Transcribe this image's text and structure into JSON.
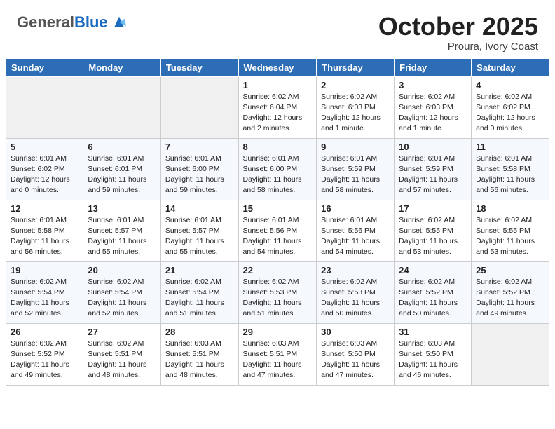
{
  "header": {
    "logo_general": "General",
    "logo_blue": "Blue",
    "month_title": "October 2025",
    "location": "Proura, Ivory Coast"
  },
  "days_of_week": [
    "Sunday",
    "Monday",
    "Tuesday",
    "Wednesday",
    "Thursday",
    "Friday",
    "Saturday"
  ],
  "weeks": [
    [
      {
        "day": "",
        "info": ""
      },
      {
        "day": "",
        "info": ""
      },
      {
        "day": "",
        "info": ""
      },
      {
        "day": "1",
        "info": "Sunrise: 6:02 AM\nSunset: 6:04 PM\nDaylight: 12 hours\nand 2 minutes."
      },
      {
        "day": "2",
        "info": "Sunrise: 6:02 AM\nSunset: 6:03 PM\nDaylight: 12 hours\nand 1 minute."
      },
      {
        "day": "3",
        "info": "Sunrise: 6:02 AM\nSunset: 6:03 PM\nDaylight: 12 hours\nand 1 minute."
      },
      {
        "day": "4",
        "info": "Sunrise: 6:02 AM\nSunset: 6:02 PM\nDaylight: 12 hours\nand 0 minutes."
      }
    ],
    [
      {
        "day": "5",
        "info": "Sunrise: 6:01 AM\nSunset: 6:02 PM\nDaylight: 12 hours\nand 0 minutes."
      },
      {
        "day": "6",
        "info": "Sunrise: 6:01 AM\nSunset: 6:01 PM\nDaylight: 11 hours\nand 59 minutes."
      },
      {
        "day": "7",
        "info": "Sunrise: 6:01 AM\nSunset: 6:00 PM\nDaylight: 11 hours\nand 59 minutes."
      },
      {
        "day": "8",
        "info": "Sunrise: 6:01 AM\nSunset: 6:00 PM\nDaylight: 11 hours\nand 58 minutes."
      },
      {
        "day": "9",
        "info": "Sunrise: 6:01 AM\nSunset: 5:59 PM\nDaylight: 11 hours\nand 58 minutes."
      },
      {
        "day": "10",
        "info": "Sunrise: 6:01 AM\nSunset: 5:59 PM\nDaylight: 11 hours\nand 57 minutes."
      },
      {
        "day": "11",
        "info": "Sunrise: 6:01 AM\nSunset: 5:58 PM\nDaylight: 11 hours\nand 56 minutes."
      }
    ],
    [
      {
        "day": "12",
        "info": "Sunrise: 6:01 AM\nSunset: 5:58 PM\nDaylight: 11 hours\nand 56 minutes."
      },
      {
        "day": "13",
        "info": "Sunrise: 6:01 AM\nSunset: 5:57 PM\nDaylight: 11 hours\nand 55 minutes."
      },
      {
        "day": "14",
        "info": "Sunrise: 6:01 AM\nSunset: 5:57 PM\nDaylight: 11 hours\nand 55 minutes."
      },
      {
        "day": "15",
        "info": "Sunrise: 6:01 AM\nSunset: 5:56 PM\nDaylight: 11 hours\nand 54 minutes."
      },
      {
        "day": "16",
        "info": "Sunrise: 6:01 AM\nSunset: 5:56 PM\nDaylight: 11 hours\nand 54 minutes."
      },
      {
        "day": "17",
        "info": "Sunrise: 6:02 AM\nSunset: 5:55 PM\nDaylight: 11 hours\nand 53 minutes."
      },
      {
        "day": "18",
        "info": "Sunrise: 6:02 AM\nSunset: 5:55 PM\nDaylight: 11 hours\nand 53 minutes."
      }
    ],
    [
      {
        "day": "19",
        "info": "Sunrise: 6:02 AM\nSunset: 5:54 PM\nDaylight: 11 hours\nand 52 minutes."
      },
      {
        "day": "20",
        "info": "Sunrise: 6:02 AM\nSunset: 5:54 PM\nDaylight: 11 hours\nand 52 minutes."
      },
      {
        "day": "21",
        "info": "Sunrise: 6:02 AM\nSunset: 5:54 PM\nDaylight: 11 hours\nand 51 minutes."
      },
      {
        "day": "22",
        "info": "Sunrise: 6:02 AM\nSunset: 5:53 PM\nDaylight: 11 hours\nand 51 minutes."
      },
      {
        "day": "23",
        "info": "Sunrise: 6:02 AM\nSunset: 5:53 PM\nDaylight: 11 hours\nand 50 minutes."
      },
      {
        "day": "24",
        "info": "Sunrise: 6:02 AM\nSunset: 5:52 PM\nDaylight: 11 hours\nand 50 minutes."
      },
      {
        "day": "25",
        "info": "Sunrise: 6:02 AM\nSunset: 5:52 PM\nDaylight: 11 hours\nand 49 minutes."
      }
    ],
    [
      {
        "day": "26",
        "info": "Sunrise: 6:02 AM\nSunset: 5:52 PM\nDaylight: 11 hours\nand 49 minutes."
      },
      {
        "day": "27",
        "info": "Sunrise: 6:02 AM\nSunset: 5:51 PM\nDaylight: 11 hours\nand 48 minutes."
      },
      {
        "day": "28",
        "info": "Sunrise: 6:03 AM\nSunset: 5:51 PM\nDaylight: 11 hours\nand 48 minutes."
      },
      {
        "day": "29",
        "info": "Sunrise: 6:03 AM\nSunset: 5:51 PM\nDaylight: 11 hours\nand 47 minutes."
      },
      {
        "day": "30",
        "info": "Sunrise: 6:03 AM\nSunset: 5:50 PM\nDaylight: 11 hours\nand 47 minutes."
      },
      {
        "day": "31",
        "info": "Sunrise: 6:03 AM\nSunset: 5:50 PM\nDaylight: 11 hours\nand 46 minutes."
      },
      {
        "day": "",
        "info": ""
      }
    ]
  ]
}
